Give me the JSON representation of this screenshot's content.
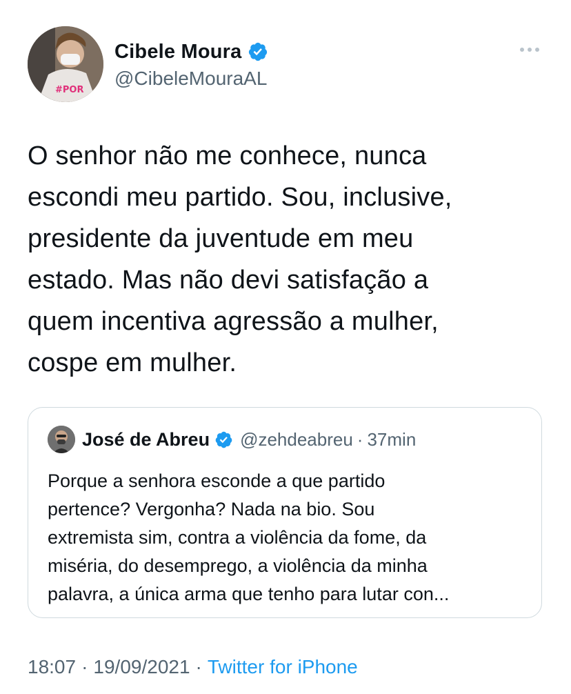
{
  "author": {
    "display_name": "Cibele Moura",
    "handle": "@CibeleMouraAL",
    "verified_icon": "verified-badge-icon",
    "avatar_shirt_text": "#PORMU\nDORTB"
  },
  "tweet": {
    "text": "O senhor não me conhece, nunca\nescondi meu partido. Sou, inclusive,\npresidente da juventude em meu\nestado. Mas não devi satisfação a\nquem incentiva agressão a mulher,\ncospe em mulher."
  },
  "quoted_tweet": {
    "display_name": "José de Abreu",
    "handle": "@zehdeabreu",
    "separator": "·",
    "time": "37min",
    "text": "Porque a senhora esconde a que partido\npertence? Vergonha? Nada na bio. Sou\nextremista sim, contra a violência da fome, da\nmiséria, do desemprego, a violência da minha\npalavra, a única arma que tenho para lutar con..."
  },
  "footer": {
    "time": "18:07",
    "separator1": "·",
    "date": "19/09/2021",
    "separator2": "·",
    "source": "Twitter for iPhone"
  },
  "colors": {
    "accent": "#1d9bf0",
    "secondary_text": "#536471",
    "border": "#cfd9de"
  },
  "icons": {
    "more": "more-horizontal-icon",
    "verified": "verified-badge-icon"
  }
}
